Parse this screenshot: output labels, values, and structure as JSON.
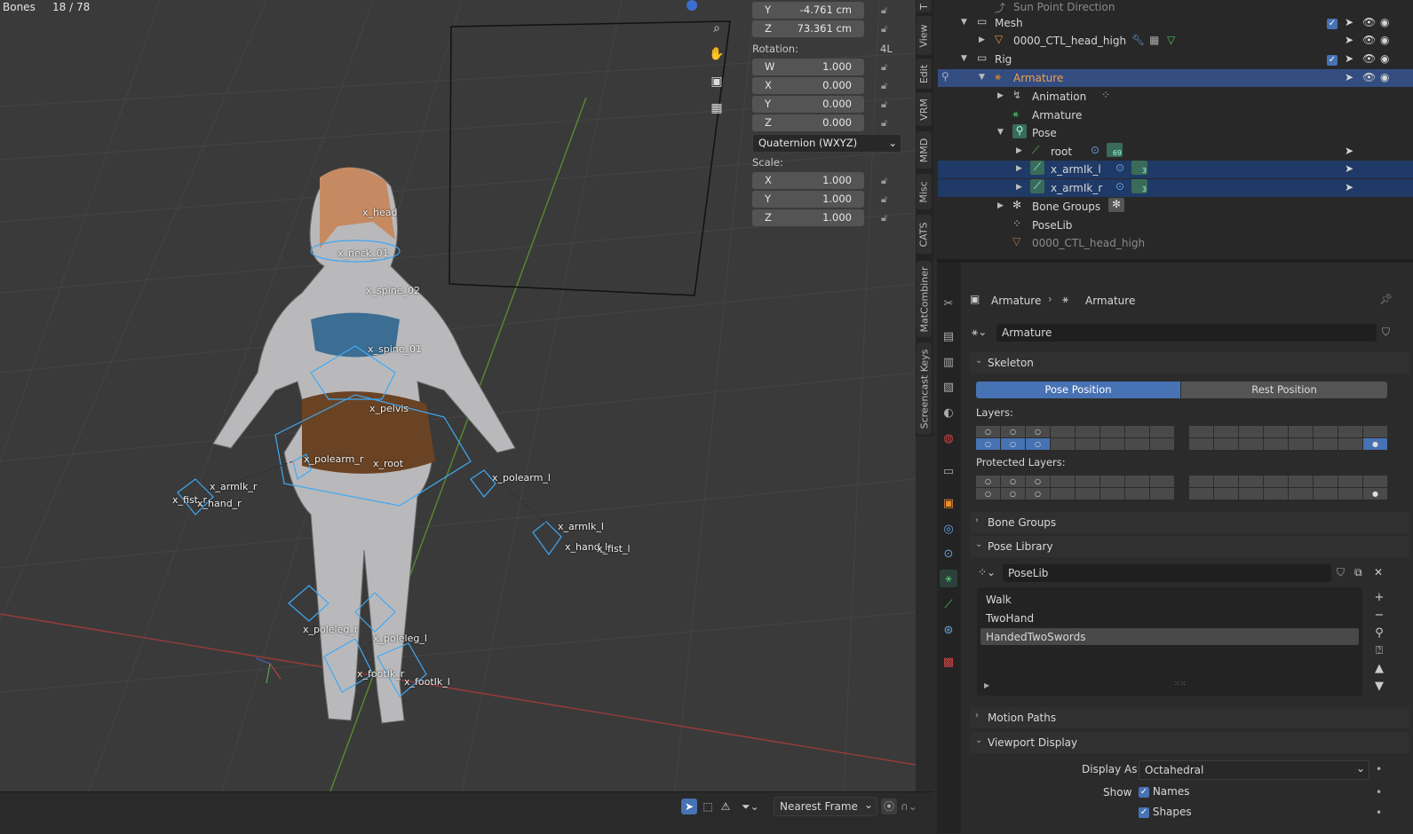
{
  "viewport": {
    "mode_label": "Bones",
    "count": "18 / 78",
    "bone_labels": [
      "x_head",
      "x_neck_01",
      "x_spine_02",
      "x_spine_01",
      "x_pelvis",
      "x_polearm_r",
      "x_root",
      "x_polearm_l",
      "x_armIk_r",
      "x_fist_r",
      "x_hand_r",
      "x_armIk_l",
      "x_hand_l",
      "x_fist_l",
      "x_poleleg_r",
      "x_poleleg_l",
      "x_footIk_r",
      "x_footIk_l"
    ]
  },
  "npanel": {
    "loc_y": {
      "label": "Y",
      "value": "-4.761 cm"
    },
    "loc_z": {
      "label": "Z",
      "value": "73.361 cm"
    },
    "rotation_label": "Rotation:",
    "rotation_mode_short": "4L",
    "rot_w": {
      "label": "W",
      "value": "1.000"
    },
    "rot_x": {
      "label": "X",
      "value": "0.000"
    },
    "rot_y": {
      "label": "Y",
      "value": "0.000"
    },
    "rot_z": {
      "label": "Z",
      "value": "0.000"
    },
    "rotation_mode": "Quaternion (WXYZ)",
    "scale_label": "Scale:",
    "scale_x": {
      "label": "X",
      "value": "1.000"
    },
    "scale_y": {
      "label": "Y",
      "value": "1.000"
    },
    "scale_z": {
      "label": "Z",
      "value": "1.000"
    }
  },
  "side_tabs": [
    "T",
    "View",
    "Edit",
    "VRM",
    "MMD",
    "Misc",
    "CATS",
    "MatCombiner",
    "Screencast Keys"
  ],
  "bottombar": {
    "interpolation": "Nearest Frame"
  },
  "outliner": {
    "rows": [
      {
        "label": "Sun Point Direction"
      },
      {
        "label": "Mesh"
      },
      {
        "label": "0000_CTL_head_high"
      },
      {
        "label": "Rig"
      },
      {
        "label": "Armature"
      },
      {
        "label": "Animation"
      },
      {
        "label": "Armature"
      },
      {
        "label": "Pose"
      },
      {
        "label": "root",
        "badge": "69"
      },
      {
        "label": "x_armIk_l",
        "badge": "3"
      },
      {
        "label": "x_armIk_r",
        "badge": "3"
      },
      {
        "label": "Bone Groups"
      },
      {
        "label": "PoseLib"
      },
      {
        "label": "0000_CTL_head_high"
      }
    ]
  },
  "properties": {
    "breadcrumb_object": "Armature",
    "breadcrumb_data": "Armature",
    "datablock_name": "Armature",
    "search_placeholder": "",
    "skeleton": {
      "title": "Skeleton",
      "pose_position": "Pose Position",
      "rest_position": "Rest Position",
      "layers_label": "Layers:",
      "protected_label": "Protected Layers:"
    },
    "bone_groups_title": "Bone Groups",
    "pose_library": {
      "title": "Pose Library",
      "datablock": "PoseLib",
      "poses": [
        "Walk",
        "TwoHand",
        "HandedTwoSwords"
      ],
      "selected_index": 2
    },
    "motion_paths_title": "Motion Paths",
    "viewport_display": {
      "title": "Viewport Display",
      "display_as_label": "Display As",
      "display_as_value": "Octahedral",
      "show_label": "Show",
      "names_label": "Names",
      "shapes_label": "Shapes"
    }
  },
  "colors": {
    "accent": "#4772b3",
    "selected_row": "#334d80",
    "armature_orange": "#e98b36",
    "bone_cyan": "#3fa9f5"
  }
}
